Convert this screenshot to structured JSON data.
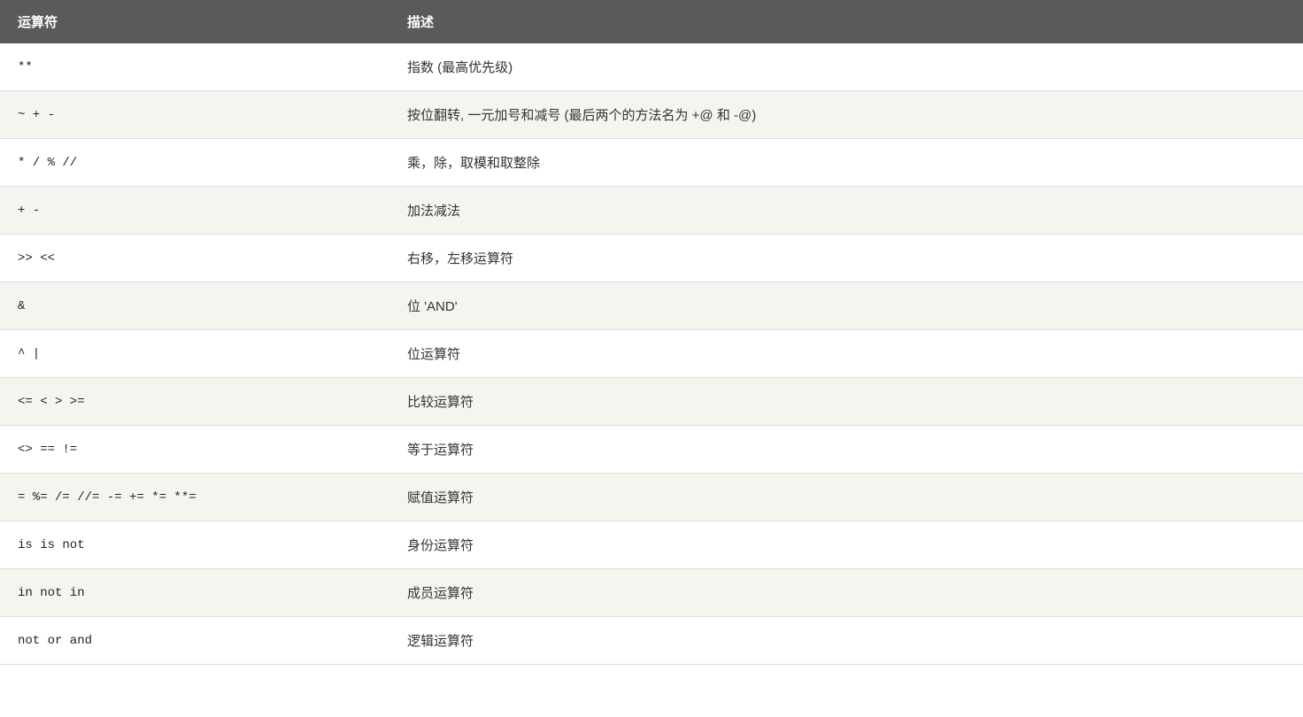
{
  "table": {
    "columns": [
      {
        "label": "运算符",
        "key": "operator"
      },
      {
        "label": "描述",
        "key": "description"
      }
    ],
    "rows": [
      {
        "operator": "**",
        "description": "指数 (最高优先级)"
      },
      {
        "operator": "~ + -",
        "description": "按位翻转, 一元加号和减号 (最后两个的方法名为 +@ 和 -@)"
      },
      {
        "operator": "* / % //",
        "description": "乘，除，取模和取整除"
      },
      {
        "operator": "+ -",
        "description": "加法减法"
      },
      {
        "operator": ">> <<",
        "description": "右移，左移运算符"
      },
      {
        "operator": "&",
        "description": "位 'AND'"
      },
      {
        "operator": "^ |",
        "description": "位运算符"
      },
      {
        "operator": "<= < > >=",
        "description": "比较运算符"
      },
      {
        "operator": "<> == !=",
        "description": "等于运算符"
      },
      {
        "operator": "= %= /= //= -= += *= **=",
        "description": "赋值运算符"
      },
      {
        "operator": "is is not",
        "description": "身份运算符"
      },
      {
        "operator": "in not in",
        "description": "成员运算符"
      },
      {
        "operator": "not or and",
        "description": "逻辑运算符"
      }
    ]
  }
}
